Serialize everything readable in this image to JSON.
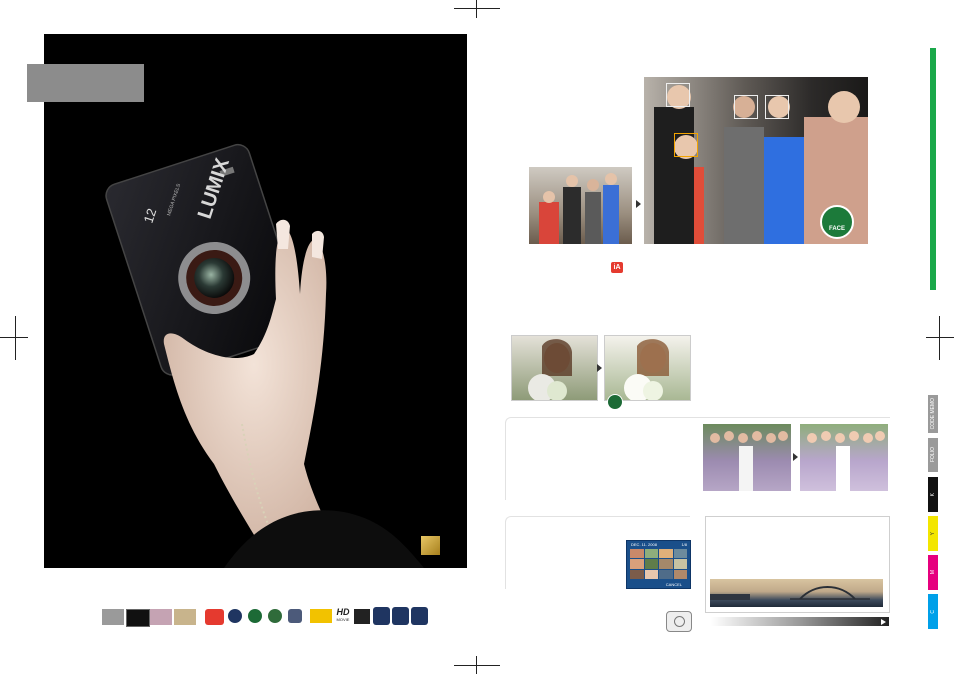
{
  "colors": {
    "green_bar": "#1aa84a",
    "gold": "#d4ad3f",
    "face_frame_active": "#f2a300",
    "ia_red": "#e53a2f",
    "navy": "#1f3561"
  },
  "side_tabs": [
    {
      "label": "CODE MEMO",
      "color": "#9a9a9a"
    },
    {
      "label": "FOLIO",
      "color": "#9a9a9a"
    },
    {
      "label": "K",
      "color": "#111111"
    },
    {
      "label": "Y",
      "color": "#f3e600"
    },
    {
      "label": "M",
      "color": "#e6007e"
    },
    {
      "label": "C",
      "color": "#00a0e9"
    }
  ],
  "camera": {
    "brand": "LUMIX",
    "megapixels": "12",
    "megapixels_unit": "MEGA PIXELS"
  },
  "lcd_screen": {
    "date": "DEC. 11. 2008",
    "count": "1/8",
    "cancel": "CANCEL"
  },
  "face_badge_text": "FACE",
  "icons": [
    "camera-silver",
    "camera-black",
    "camera-pink",
    "camera-gold",
    "ia-icon",
    "mode-icon",
    "face-icon",
    "globe-icon",
    "stabilizer-icon",
    "lens-icon",
    "hd-movie-icon",
    "sd-icon",
    "navy-block",
    "navy-block",
    "navy-block",
    "camera-outline-icon",
    "arrow-right-icon"
  ],
  "hd_label": "HD",
  "hd_sublabel": "MOVIE",
  "ia_label": "iA"
}
